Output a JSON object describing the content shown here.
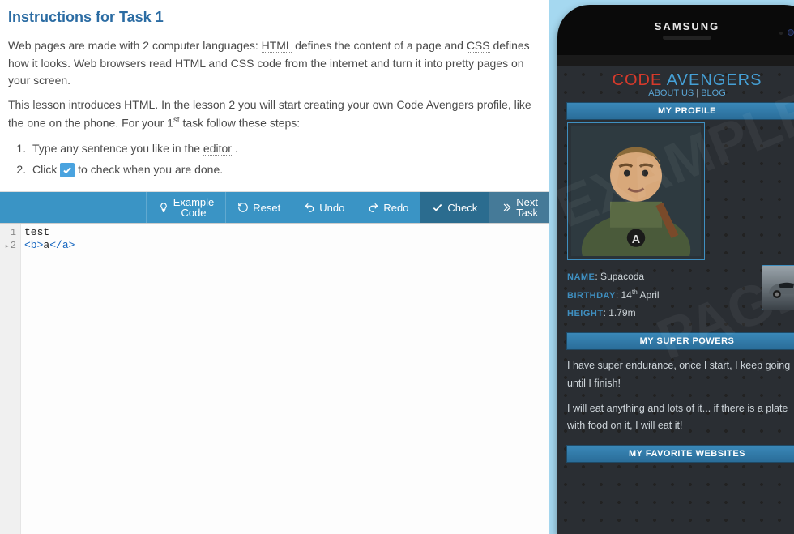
{
  "instructions": {
    "title": "Instructions for Task 1",
    "p1a": "Web pages are made with 2 computer languages: ",
    "html": "HTML",
    "p1b": " defines the content of a page and ",
    "css": "CSS",
    "p1c": " defines how it looks. ",
    "web_browsers": "Web browsers",
    "p1d": " read HTML and CSS code from the internet and turn it into pretty pages on your screen.",
    "p2a": "This lesson introduces HTML. In the lesson 2 you will start creating your own Code Avengers profile, like the one on the phone. For your 1",
    "p2sup": "st",
    "p2b": " task follow these steps:",
    "li1a": "Type any sentence you like in the ",
    "editor_word": "editor",
    "li1b": " .",
    "li2a": "Click ",
    "li2b": " to check when you are done."
  },
  "toolbar": {
    "example_l1": "Example",
    "example_l2": "Code",
    "reset": "Reset",
    "undo": "Undo",
    "redo": "Redo",
    "check": "Check",
    "next_l1": "Next",
    "next_l2": "Task"
  },
  "editor": {
    "line1": "test",
    "line2_open": "<b>",
    "line2_text": "a",
    "line2_close": "</a>",
    "g1": "1",
    "g2": "2"
  },
  "phone": {
    "brand": "SAMSUNG",
    "logo1": "CODE",
    "logo2": "AVENGERS",
    "about": "ABOUT US",
    "blog": "BLOG",
    "sec_profile": "MY PROFILE",
    "name_k": "NAME",
    "name_v": ": Supacoda",
    "bday_k": "BIRTHDAY",
    "bday_v1": ": 14",
    "bday_sup": "th",
    "bday_v2": " April",
    "height_k": "HEIGHT",
    "height_v": ": 1.79m",
    "sec_powers": "MY SUPER POWERS",
    "power1": "I have super endurance, once I start, I keep going until I finish!",
    "power2": "I will eat anything and lots of it... if there is a plate with food on it, I will eat it!",
    "sec_sites": "MY FAVORITE WEBSITES"
  }
}
